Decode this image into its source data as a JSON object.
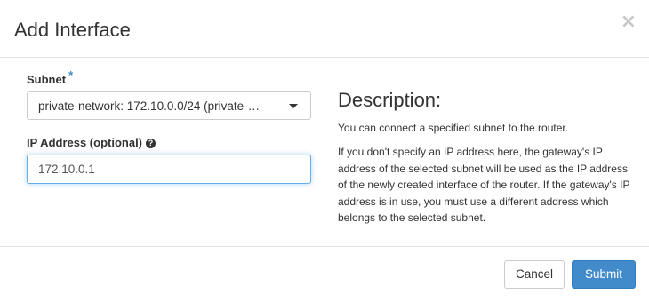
{
  "dialog": {
    "title": "Add Interface",
    "close_symbol": "×"
  },
  "form": {
    "subnet": {
      "label": "Subnet",
      "required_mark": "*",
      "selected_value": "private-network: 172.10.0.0/24 (private-…"
    },
    "ip_address": {
      "label": "IP Address (optional)",
      "help_icon": "?",
      "value": "172.10.0.1"
    }
  },
  "description": {
    "title": "Description:",
    "paragraph_1": "You can connect a specified subnet to the router.",
    "paragraph_2": "If you don't specify an IP address here, the gateway's IP address of the selected subnet will be used as the IP address of the newly created interface of the router. If the gateway's IP address is in use, you must use a different address which belongs to the selected subnet."
  },
  "footer": {
    "cancel_label": "Cancel",
    "submit_label": "Submit"
  },
  "colors": {
    "accent": "#428bca",
    "focus_border": "#66afe9",
    "border": "#cccccc",
    "text": "#333333"
  }
}
